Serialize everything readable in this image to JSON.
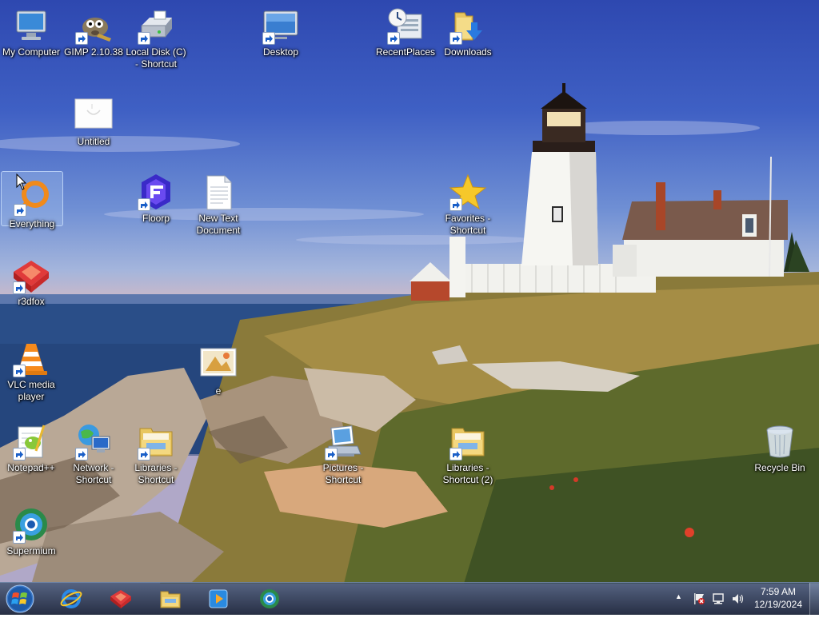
{
  "desktop": {
    "icons": [
      {
        "label": "My Computer",
        "icon": "computer-icon",
        "shortcut": false
      },
      {
        "label": "GIMP 2.10.38",
        "icon": "gimp-icon",
        "shortcut": true
      },
      {
        "label": "Local Disk (C) - Shortcut",
        "icon": "hard-drive-icon",
        "shortcut": true
      },
      {
        "label": "Desktop",
        "icon": "desktop-folder-icon",
        "shortcut": true
      },
      {
        "label": "RecentPlaces",
        "icon": "recent-places-icon",
        "shortcut": true
      },
      {
        "label": "Downloads",
        "icon": "downloads-folder-icon",
        "shortcut": true
      },
      {
        "label": "Untitled",
        "icon": "paint-image-icon",
        "shortcut": false
      },
      {
        "label": "Everything",
        "icon": "everything-search-icon",
        "shortcut": true,
        "selected": true
      },
      {
        "label": "Floorp",
        "icon": "floorp-browser-icon",
        "shortcut": true
      },
      {
        "label": "New Text Document",
        "icon": "text-document-icon",
        "shortcut": false
      },
      {
        "label": "Favorites - Shortcut",
        "icon": "favorites-star-icon",
        "shortcut": true
      },
      {
        "label": "r3dfox",
        "icon": "r3dfox-browser-icon",
        "shortcut": true
      },
      {
        "label": "VLC media player",
        "icon": "vlc-cone-icon",
        "shortcut": true
      },
      {
        "label": "e",
        "icon": "image-file-icon",
        "shortcut": false
      },
      {
        "label": "Notepad++",
        "icon": "notepad-plus-plus-icon",
        "shortcut": true
      },
      {
        "label": "Network - Shortcut",
        "icon": "network-globe-icon",
        "shortcut": true
      },
      {
        "label": "Libraries - Shortcut",
        "icon": "libraries-folder-icon",
        "shortcut": true
      },
      {
        "label": "Pictures - Shortcut",
        "icon": "pictures-icon",
        "shortcut": true
      },
      {
        "label": "Libraries - Shortcut (2)",
        "icon": "libraries-folder-icon",
        "shortcut": true
      },
      {
        "label": "Recycle Bin",
        "icon": "recycle-bin-icon",
        "shortcut": false
      },
      {
        "label": "Supermium",
        "icon": "supermium-browser-icon",
        "shortcut": true
      }
    ]
  },
  "taskbar": {
    "pinned": [
      {
        "icon": "internet-explorer-icon"
      },
      {
        "icon": "r3dfox-browser-icon"
      },
      {
        "icon": "file-explorer-icon"
      },
      {
        "icon": "media-player-icon"
      },
      {
        "icon": "supermium-browser-icon"
      }
    ],
    "tray_arrow": "▲",
    "clock": {
      "time": "7:59 AM",
      "date": "12/19/2024"
    }
  },
  "colors": {
    "taskbar": "#1c2a40",
    "label_text": "#ffffff",
    "selection": "#aac8f0"
  }
}
